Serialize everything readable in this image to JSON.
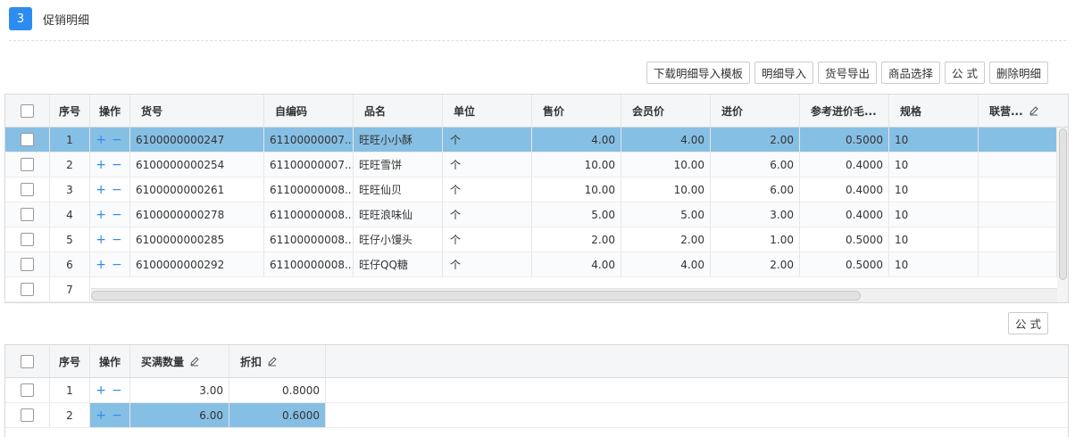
{
  "section": {
    "number": "3",
    "title": "促销明细"
  },
  "toolbar1": [
    "下载明细导入模板",
    "明细导入",
    "货号导出",
    "商品选择",
    "公 式",
    "删除明细"
  ],
  "toolbar2": [
    "公 式"
  ],
  "table1": {
    "headers": [
      "序号",
      "操作",
      "货号",
      "自编码",
      "品名",
      "单位",
      "售价",
      "会员价",
      "进价",
      "参考进价毛...",
      "规格",
      "联营..."
    ],
    "rows": [
      {
        "seq": "1",
        "code": "6100000000247",
        "selfcode": "61100000007...",
        "name": "旺旺小小酥",
        "unit": "个",
        "price": "4.00",
        "member": "4.00",
        "cost": "2.00",
        "margin": "0.5000",
        "spec": "10"
      },
      {
        "seq": "2",
        "code": "6100000000254",
        "selfcode": "61100000007...",
        "name": "旺旺雪饼",
        "unit": "个",
        "price": "10.00",
        "member": "10.00",
        "cost": "6.00",
        "margin": "0.4000",
        "spec": "10"
      },
      {
        "seq": "3",
        "code": "6100000000261",
        "selfcode": "61100000008...",
        "name": "旺旺仙贝",
        "unit": "个",
        "price": "10.00",
        "member": "10.00",
        "cost": "6.00",
        "margin": "0.4000",
        "spec": "10"
      },
      {
        "seq": "4",
        "code": "6100000000278",
        "selfcode": "61100000008...",
        "name": "旺旺浪味仙",
        "unit": "个",
        "price": "5.00",
        "member": "5.00",
        "cost": "3.00",
        "margin": "0.4000",
        "spec": "10"
      },
      {
        "seq": "5",
        "code": "6100000000285",
        "selfcode": "61100000008...",
        "name": "旺仔小馒头",
        "unit": "个",
        "price": "2.00",
        "member": "2.00",
        "cost": "1.00",
        "margin": "0.5000",
        "spec": "10"
      },
      {
        "seq": "6",
        "code": "6100000000292",
        "selfcode": "61100000008...",
        "name": "旺仔QQ糖",
        "unit": "个",
        "price": "4.00",
        "member": "4.00",
        "cost": "2.00",
        "margin": "0.5000",
        "spec": "10"
      }
    ],
    "partial_seq": "7"
  },
  "table2": {
    "headers": [
      "序号",
      "操作",
      "买满数量",
      "折扣"
    ],
    "rows": [
      {
        "seq": "1",
        "qty": "3.00",
        "discount": "0.8000"
      },
      {
        "seq": "2",
        "qty": "6.00",
        "discount": "0.6000"
      }
    ]
  },
  "ops": {
    "add": "+",
    "remove": "−"
  },
  "icons": {
    "edit": "pencil-icon"
  },
  "colors": {
    "accent": "#2d8cf0",
    "selected_row": "#86bfe4"
  }
}
